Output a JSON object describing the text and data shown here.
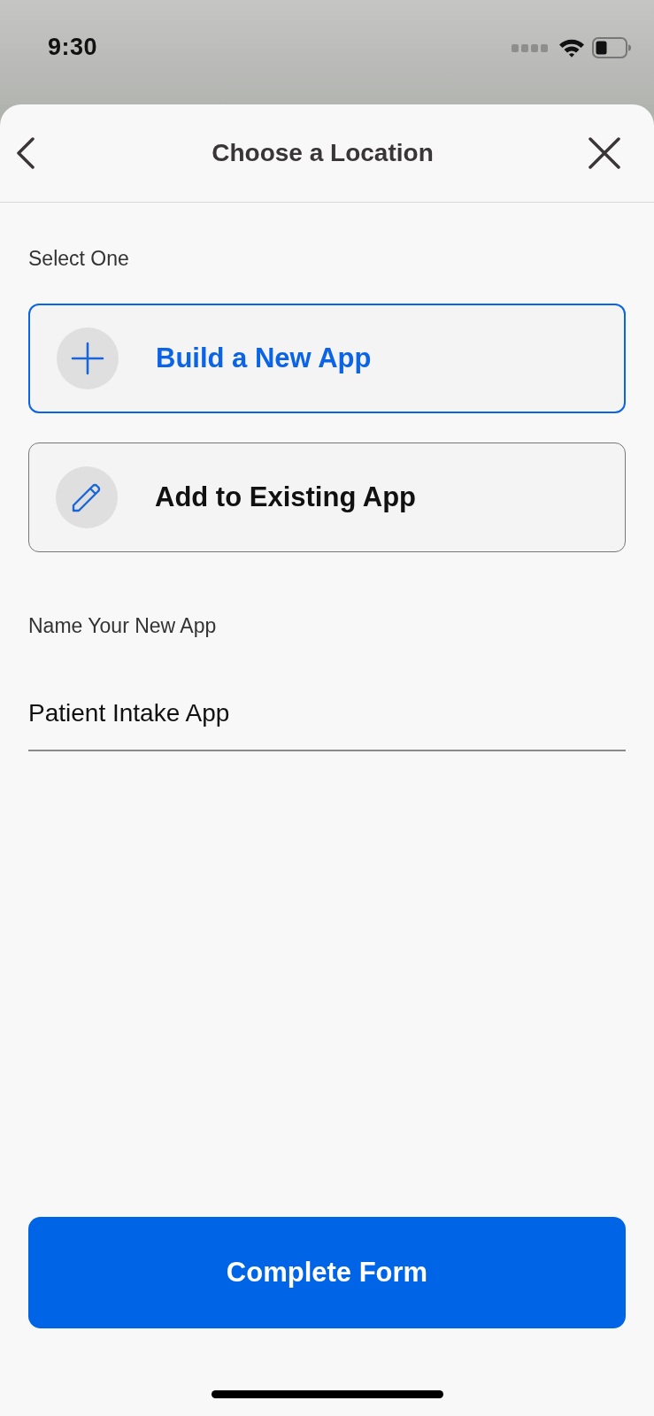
{
  "status_bar": {
    "time": "9:30"
  },
  "header": {
    "title": "Choose a Location"
  },
  "options_label": "Select One",
  "options": [
    {
      "kind": "plus",
      "label": "Build a New App",
      "selected": true
    },
    {
      "kind": "pencil",
      "label": "Add to Existing App",
      "selected": false
    }
  ],
  "name_field": {
    "label": "Name Your New App",
    "value": "Patient Intake App"
  },
  "primary_button": {
    "label": "Complete Form"
  }
}
